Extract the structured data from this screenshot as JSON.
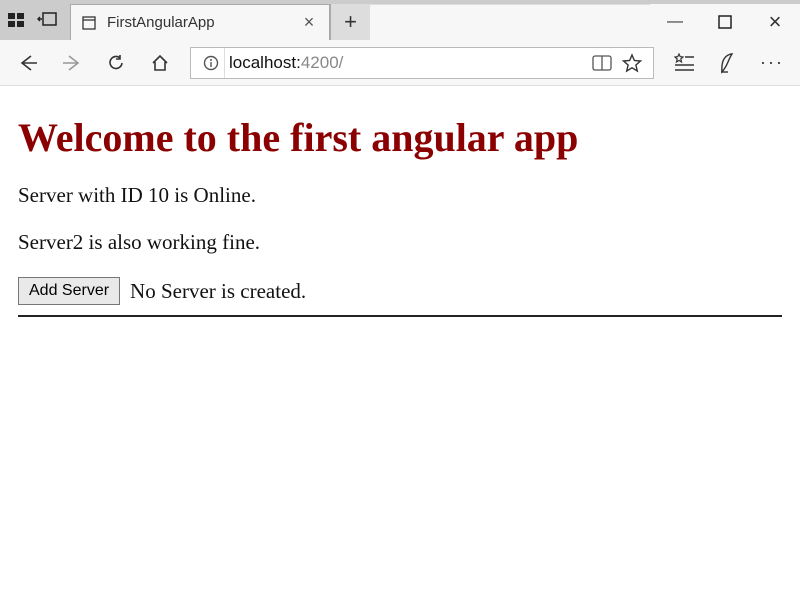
{
  "browser": {
    "tab": {
      "title": "FirstAngularApp",
      "close_glyph": "×"
    },
    "newtab_glyph": "+",
    "window": {
      "minimize_glyph": "—",
      "maximize_glyph": "□",
      "close_glyph": "×"
    },
    "address": {
      "host": "localhost:",
      "port_path": "4200/"
    }
  },
  "content": {
    "heading": "Welcome to the first angular app",
    "line1": "Server with ID 10 is Online.",
    "line2": "Server2 is also working fine.",
    "add_button_label": "Add Server",
    "status_text": "No Server is created."
  }
}
